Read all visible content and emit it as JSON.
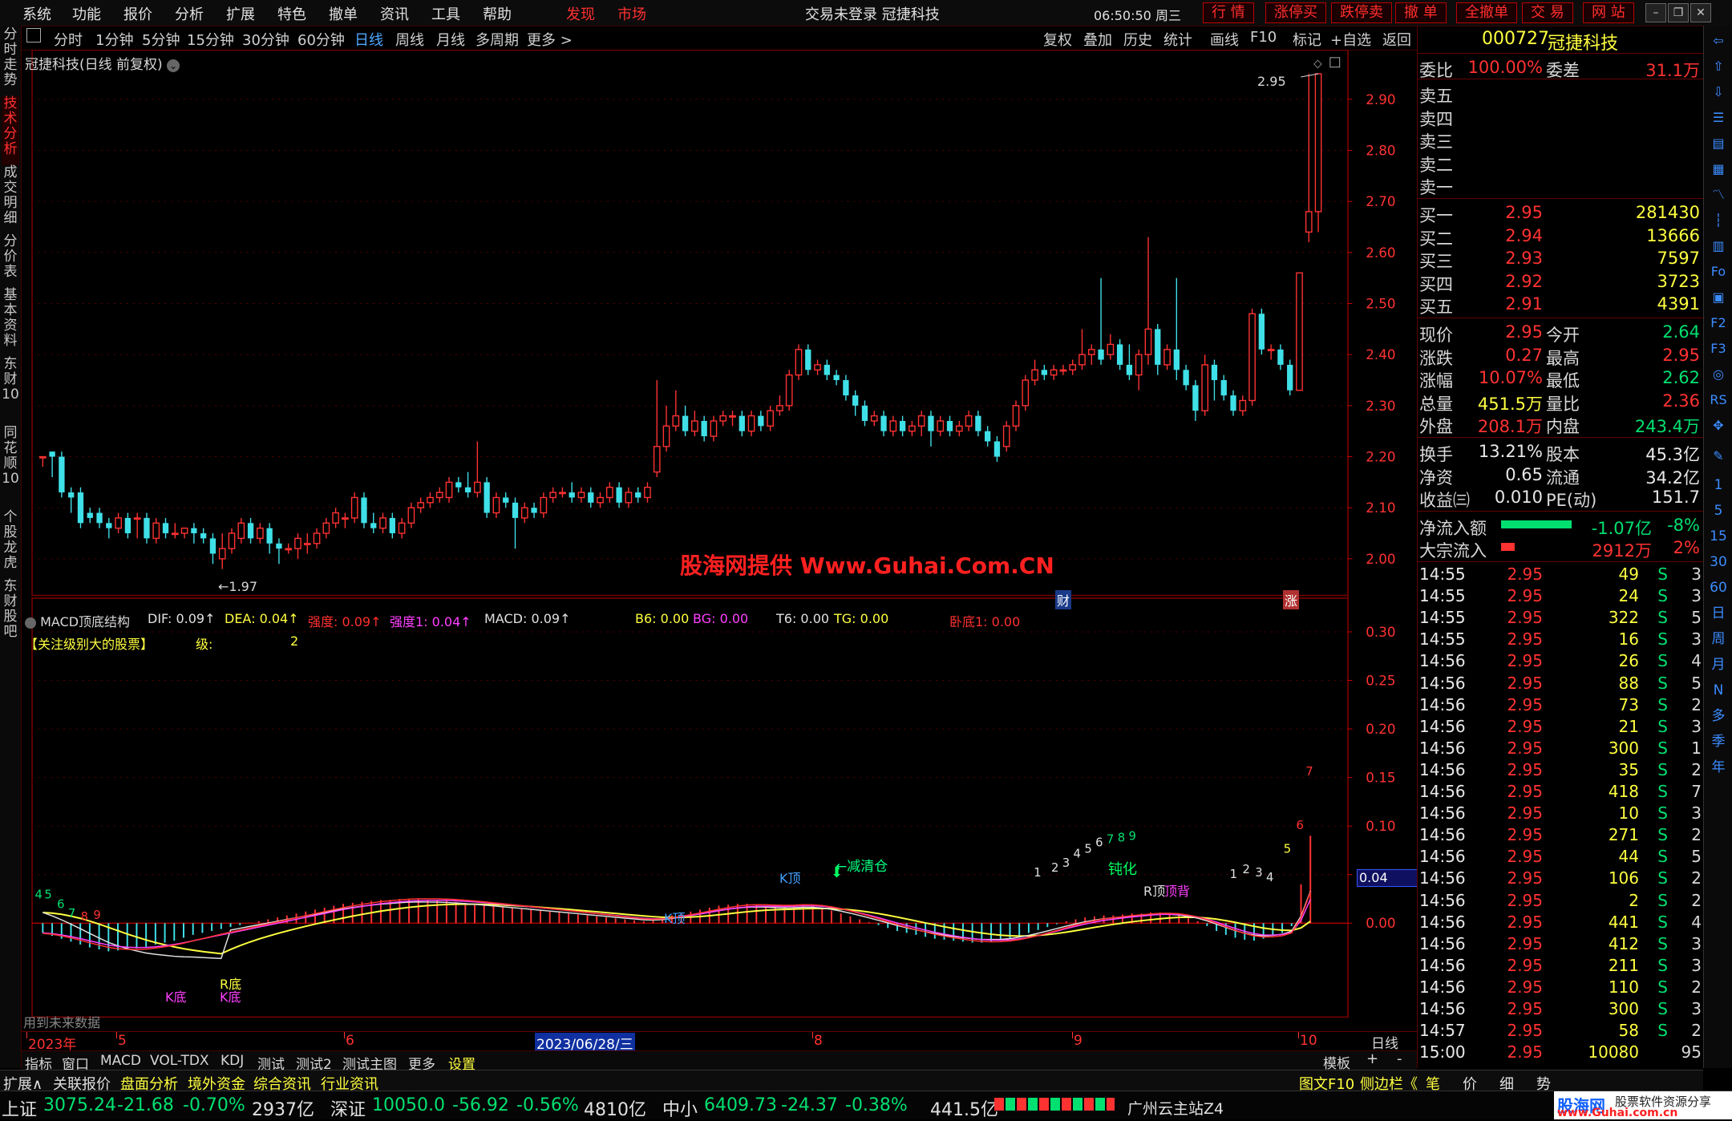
{
  "topbar": {
    "menus": [
      "系统",
      "功能",
      "报价",
      "分析",
      "扩展",
      "特色",
      "撤单",
      "资讯",
      "工具",
      "帮助"
    ],
    "discover": "发现",
    "market": "市场",
    "title": "交易未登录  冠捷科技",
    "time": "06:50:50 周三",
    "buttons": [
      "行  情",
      "涨停买",
      "跌停卖",
      "撤  单",
      "全撤单",
      "交  易",
      "网  站"
    ]
  },
  "left_tabs": [
    "分时走势",
    "技术分析",
    "成交明细",
    "分价表",
    "基本资料",
    "东财10",
    "同花顺10",
    "个股龙虎",
    "东财股吧"
  ],
  "period_bar": {
    "periods": [
      "分时",
      "1分钟",
      "5分钟",
      "15分钟",
      "30分钟",
      "60分钟",
      "日线",
      "周线",
      "月线",
      "多周期",
      "更多 >"
    ],
    "active_period": "日线",
    "tools": [
      "复权",
      "叠加",
      "历史",
      "统计",
      "画线",
      "F10",
      "标记",
      "+自选",
      "返回"
    ]
  },
  "main_chart": {
    "title": "冠捷科技(日线 前复权)",
    "high_label": "2.95",
    "low_label": "←1.97",
    "y_ticks": [
      "2.90",
      "2.80",
      "2.70",
      "2.60",
      "2.50",
      "2.40",
      "2.30",
      "2.20",
      "2.10",
      "2.00"
    ],
    "watermark": "股海网提供 Www.Guhai.Com.CN",
    "marker_cai": "财",
    "marker_zhang": "涨"
  },
  "indicator": {
    "name": "MACD顶底结构",
    "params": [
      {
        "text": "DIF: 0.09↑",
        "color": "#e0e0e0"
      },
      {
        "text": "DEA: 0.04↑",
        "color": "#ffff40"
      },
      {
        "text": "强度: 0.09↑",
        "color": "#ff3030"
      },
      {
        "text": "强度1: 0.04↑",
        "color": "#ff40ff"
      },
      {
        "text": "MACD: 0.09↑",
        "color": "#e0e0e0"
      },
      {
        "text": "B6: 0.00",
        "color": "#ffff40"
      },
      {
        "text": "BG: 0.00",
        "color": "#ff40ff"
      },
      {
        "text": "T6: 0.00",
        "color": "#e0e0e0"
      },
      {
        "text": "TG: 0.00",
        "color": "#ffff40"
      },
      {
        "text": "卧底1: 0.00",
        "color": "#ff3030"
      }
    ],
    "note_label": "【关注级别大的股票】",
    "level_label": "级:",
    "level_value": "2",
    "y_ticks": [
      "0.30",
      "0.25",
      "0.20",
      "0.15",
      "0.10",
      "0.05",
      "0.00"
    ],
    "current_value": "0.04",
    "future_note": "用到未来数据",
    "annotations": {
      "k_top_1": "K顶",
      "k_top_2": "K顶",
      "reduce": "减清仓",
      "dull": "钝化",
      "r_top": "R顶",
      "top_bottom": "顶背",
      "r_bottom": "R底",
      "k_bottom_1": "K底",
      "k_bottom_2": "K底"
    },
    "count_labels": [
      "4",
      "5",
      "6",
      "7",
      "8",
      "9",
      "1",
      "2",
      "3",
      "4",
      "5",
      "6",
      "7",
      "8",
      "9",
      "1",
      "2",
      "3",
      "4",
      "5",
      "6",
      "7"
    ]
  },
  "x_axis": {
    "labels": [
      "2023年",
      "5",
      "6",
      "2023/06/28/三",
      "8",
      "9",
      "10"
    ],
    "right_label": "日线"
  },
  "template_bar": {
    "label": "模板",
    "plus": "+",
    "minus": "-"
  },
  "indicator_tabs": [
    "指标",
    "窗口",
    "MACD",
    "VOL-TDX",
    "KDJ",
    "测试",
    "测试2",
    "测试主图",
    "更多",
    "设置"
  ],
  "function_tabs": [
    "扩展∧",
    "关联报价",
    "盘面分析",
    "境外资金",
    "综合资讯",
    "行业资讯"
  ],
  "function_tabs_right": [
    "图文F10",
    "侧边栏《"
  ],
  "right_bottom_tabs": [
    "笔",
    "价",
    "细",
    "势"
  ],
  "quote": {
    "code": "000727",
    "name": "冠捷科技",
    "weibi_label": "委比",
    "weibi": "100.00%",
    "weicha_label": "委差",
    "weicha": "31.1万",
    "sell": [
      {
        "label": "卖五",
        "price": "",
        "vol": ""
      },
      {
        "label": "卖四",
        "price": "",
        "vol": ""
      },
      {
        "label": "卖三",
        "price": "",
        "vol": ""
      },
      {
        "label": "卖二",
        "price": "",
        "vol": ""
      },
      {
        "label": "卖一",
        "price": "",
        "vol": ""
      }
    ],
    "buy": [
      {
        "label": "买一",
        "price": "2.95",
        "vol": "281430"
      },
      {
        "label": "买二",
        "price": "2.94",
        "vol": "13666"
      },
      {
        "label": "买三",
        "price": "2.93",
        "vol": "7597"
      },
      {
        "label": "买四",
        "price": "2.92",
        "vol": "3723"
      },
      {
        "label": "买五",
        "price": "2.91",
        "vol": "4391"
      }
    ],
    "stats": [
      {
        "l1": "现价",
        "v1": "2.95",
        "c1": "#ff3232",
        "l2": "今开",
        "v2": "2.64",
        "c2": "#00e070"
      },
      {
        "l1": "涨跌",
        "v1": "0.27",
        "c1": "#ff3232",
        "l2": "最高",
        "v2": "2.95",
        "c2": "#ff3232"
      },
      {
        "l1": "涨幅",
        "v1": "10.07%",
        "c1": "#ff3232",
        "l2": "最低",
        "v2": "2.62",
        "c2": "#00e070"
      },
      {
        "l1": "总量",
        "v1": "451.5万",
        "c1": "#ffff40",
        "l2": "量比",
        "v2": "2.36",
        "c2": "#ff3232"
      },
      {
        "l1": "外盘",
        "v1": "208.1万",
        "c1": "#ff3232",
        "l2": "内盘",
        "v2": "243.4万",
        "c2": "#00e070"
      }
    ],
    "stats2": [
      {
        "l1": "换手",
        "v1": "13.21%",
        "l2": "股本",
        "v2": "45.3亿"
      },
      {
        "l1": "净资",
        "v1": "0.65",
        "l2": "流通",
        "v2": "34.2亿"
      },
      {
        "l1": "收益㈢",
        "v1": "0.010",
        "l2": "PE(动)",
        "v2": "151.7"
      }
    ],
    "flow": [
      {
        "label": "净流入额",
        "value": "-1.07亿",
        "pct": "-8%",
        "color": "#00e070",
        "bar": "#00e070",
        "bar_frac": 0.8
      },
      {
        "label": "大宗流入",
        "value": "2912万",
        "pct": "2%",
        "color": "#ff3232",
        "bar": "#ff3232",
        "bar_frac": 0.15
      }
    ],
    "ticks": [
      {
        "t": "14:55",
        "p": "2.95",
        "v": "49",
        "s": "S",
        "n": "3"
      },
      {
        "t": "14:55",
        "p": "2.95",
        "v": "24",
        "s": "S",
        "n": "3"
      },
      {
        "t": "14:55",
        "p": "2.95",
        "v": "322",
        "s": "S",
        "n": "5"
      },
      {
        "t": "14:55",
        "p": "2.95",
        "v": "16",
        "s": "S",
        "n": "3"
      },
      {
        "t": "14:56",
        "p": "2.95",
        "v": "26",
        "s": "S",
        "n": "4"
      },
      {
        "t": "14:56",
        "p": "2.95",
        "v": "88",
        "s": "S",
        "n": "5"
      },
      {
        "t": "14:56",
        "p": "2.95",
        "v": "73",
        "s": "S",
        "n": "2"
      },
      {
        "t": "14:56",
        "p": "2.95",
        "v": "21",
        "s": "S",
        "n": "3"
      },
      {
        "t": "14:56",
        "p": "2.95",
        "v": "300",
        "s": "S",
        "n": "1"
      },
      {
        "t": "14:56",
        "p": "2.95",
        "v": "35",
        "s": "S",
        "n": "2"
      },
      {
        "t": "14:56",
        "p": "2.95",
        "v": "418",
        "s": "S",
        "n": "7"
      },
      {
        "t": "14:56",
        "p": "2.95",
        "v": "10",
        "s": "S",
        "n": "3"
      },
      {
        "t": "14:56",
        "p": "2.95",
        "v": "271",
        "s": "S",
        "n": "2"
      },
      {
        "t": "14:56",
        "p": "2.95",
        "v": "44",
        "s": "S",
        "n": "5"
      },
      {
        "t": "14:56",
        "p": "2.95",
        "v": "106",
        "s": "S",
        "n": "2"
      },
      {
        "t": "14:56",
        "p": "2.95",
        "v": "2",
        "s": "S",
        "n": "2"
      },
      {
        "t": "14:56",
        "p": "2.95",
        "v": "441",
        "s": "S",
        "n": "4"
      },
      {
        "t": "14:56",
        "p": "2.95",
        "v": "412",
        "s": "S",
        "n": "3"
      },
      {
        "t": "14:56",
        "p": "2.95",
        "v": "211",
        "s": "S",
        "n": "3"
      },
      {
        "t": "14:56",
        "p": "2.95",
        "v": "110",
        "s": "S",
        "n": "2"
      },
      {
        "t": "14:56",
        "p": "2.95",
        "v": "300",
        "s": "S",
        "n": "3"
      },
      {
        "t": "14:57",
        "p": "2.95",
        "v": "58",
        "s": "S",
        "n": "2"
      },
      {
        "t": "15:00",
        "p": "2.95",
        "v": "10080",
        "s": "",
        "n": "95"
      }
    ]
  },
  "right_icons": [
    "up-arrow-icon",
    "down-arrow-icon",
    "list-icon",
    "bar-icon",
    "grid-icon",
    "line-icon",
    "candle-icon",
    "table-icon",
    "f10-icon",
    "doc-icon",
    "f2-icon",
    "f3-icon",
    "compass-icon",
    "rsi-icon",
    "move-icon",
    "pen-icon",
    "f5-icon"
  ],
  "right_periods": [
    "1",
    "5",
    "15",
    "30",
    "60",
    "日",
    "周",
    "月",
    "N",
    "多",
    "季",
    "年"
  ],
  "status": {
    "sh_label": "上证",
    "sh": "3075.24",
    "sh_chg": "-21.68",
    "sh_pct": "-0.70%",
    "sh_amt": "2937亿",
    "sz_label": "深证",
    "sz": "10050.0",
    "sz_chg": "-56.92",
    "sz_pct": "-0.56%",
    "sz_amt": "4810亿",
    "zx_label": "中小",
    "zx": "6409.73",
    "zx_chg": "-24.37",
    "zx_pct": "-0.38%",
    "zx_amt": "441.5亿",
    "server": "广州云主站Z4",
    "logo": "股海网",
    "logo_sub": "股票软件资源分享",
    "logo_url": "www.Guhai.com.cn"
  },
  "candles": [
    [
      2.2,
      2.2,
      2.18,
      2.2
    ],
    [
      2.21,
      2.2,
      2.16,
      2.21
    ],
    [
      2.2,
      2.13,
      2.12,
      2.21
    ],
    [
      2.13,
      2.12,
      2.09,
      2.14
    ],
    [
      2.13,
      2.07,
      2.06,
      2.14
    ],
    [
      2.09,
      2.08,
      2.07,
      2.1
    ],
    [
      2.09,
      2.07,
      2.06,
      2.1
    ],
    [
      2.07,
      2.06,
      2.04,
      2.08
    ],
    [
      2.06,
      2.08,
      2.05,
      2.09
    ],
    [
      2.08,
      2.05,
      2.04,
      2.09
    ],
    [
      2.08,
      2.08,
      2.04,
      2.09
    ],
    [
      2.08,
      2.04,
      2.03,
      2.09
    ],
    [
      2.04,
      2.07,
      2.03,
      2.08
    ],
    [
      2.07,
      2.05,
      2.04,
      2.08
    ],
    [
      2.05,
      2.05,
      2.04,
      2.07
    ],
    [
      2.05,
      2.06,
      2.04,
      2.06
    ],
    [
      2.06,
      2.05,
      2.03,
      2.07
    ],
    [
      2.05,
      2.04,
      2.03,
      2.06
    ],
    [
      2.04,
      2.01,
      1.99,
      2.05
    ],
    [
      2.0,
      2.02,
      1.98,
      2.05
    ],
    [
      2.02,
      2.05,
      2.01,
      2.06
    ],
    [
      2.04,
      2.07,
      2.03,
      2.08
    ],
    [
      2.07,
      2.04,
      2.03,
      2.08
    ],
    [
      2.04,
      2.06,
      2.03,
      2.07
    ],
    [
      2.06,
      2.03,
      2.01,
      2.07
    ],
    [
      2.03,
      2.02,
      1.99,
      2.04
    ],
    [
      2.02,
      2.02,
      2.01,
      2.03
    ],
    [
      2.02,
      2.04,
      2.0,
      2.05
    ],
    [
      2.03,
      2.03,
      2.01,
      2.05
    ],
    [
      2.03,
      2.05,
      2.02,
      2.06
    ],
    [
      2.05,
      2.07,
      2.04,
      2.08
    ],
    [
      2.07,
      2.09,
      2.06,
      2.1
    ],
    [
      2.08,
      2.08,
      2.06,
      2.09
    ],
    [
      2.08,
      2.12,
      2.07,
      2.13
    ],
    [
      2.12,
      2.07,
      2.06,
      2.13
    ],
    [
      2.07,
      2.06,
      2.05,
      2.09
    ],
    [
      2.06,
      2.08,
      2.05,
      2.09
    ],
    [
      2.08,
      2.05,
      2.04,
      2.09
    ],
    [
      2.05,
      2.07,
      2.04,
      2.08
    ],
    [
      2.07,
      2.1,
      2.06,
      2.11
    ],
    [
      2.1,
      2.11,
      2.09,
      2.12
    ],
    [
      2.11,
      2.12,
      2.1,
      2.13
    ],
    [
      2.12,
      2.13,
      2.11,
      2.14
    ],
    [
      2.12,
      2.15,
      2.11,
      2.16
    ],
    [
      2.15,
      2.14,
      2.13,
      2.16
    ],
    [
      2.14,
      2.13,
      2.12,
      2.17
    ],
    [
      2.13,
      2.15,
      2.12,
      2.23
    ],
    [
      2.15,
      2.09,
      2.08,
      2.16
    ],
    [
      2.09,
      2.12,
      2.08,
      2.13
    ],
    [
      2.12,
      2.11,
      2.1,
      2.13
    ],
    [
      2.11,
      2.08,
      2.02,
      2.12
    ],
    [
      2.08,
      2.1,
      2.07,
      2.11
    ],
    [
      2.1,
      2.09,
      2.08,
      2.11
    ],
    [
      2.09,
      2.12,
      2.08,
      2.13
    ],
    [
      2.12,
      2.13,
      2.11,
      2.14
    ],
    [
      2.13,
      2.13,
      2.12,
      2.14
    ],
    [
      2.13,
      2.12,
      2.11,
      2.15
    ],
    [
      2.12,
      2.13,
      2.11,
      2.14
    ],
    [
      2.13,
      2.11,
      2.1,
      2.14
    ],
    [
      2.11,
      2.12,
      2.1,
      2.13
    ],
    [
      2.12,
      2.14,
      2.11,
      2.15
    ],
    [
      2.14,
      2.11,
      2.1,
      2.15
    ],
    [
      2.11,
      2.13,
      2.1,
      2.14
    ],
    [
      2.13,
      2.12,
      2.11,
      2.14
    ],
    [
      2.12,
      2.14,
      2.11,
      2.15
    ],
    [
      2.17,
      2.22,
      2.16,
      2.35
    ],
    [
      2.22,
      2.26,
      2.21,
      2.3
    ],
    [
      2.26,
      2.28,
      2.25,
      2.33
    ],
    [
      2.28,
      2.25,
      2.24,
      2.3
    ],
    [
      2.25,
      2.27,
      2.24,
      2.29
    ],
    [
      2.27,
      2.24,
      2.23,
      2.28
    ],
    [
      2.24,
      2.27,
      2.23,
      2.28
    ],
    [
      2.27,
      2.28,
      2.26,
      2.29
    ],
    [
      2.28,
      2.28,
      2.26,
      2.29
    ],
    [
      2.28,
      2.25,
      2.24,
      2.29
    ],
    [
      2.25,
      2.28,
      2.24,
      2.29
    ],
    [
      2.28,
      2.26,
      2.25,
      2.29
    ],
    [
      2.26,
      2.29,
      2.25,
      2.3
    ],
    [
      2.29,
      2.3,
      2.28,
      2.32
    ],
    [
      2.3,
      2.36,
      2.29,
      2.37
    ],
    [
      2.36,
      2.41,
      2.35,
      2.42
    ],
    [
      2.41,
      2.37,
      2.36,
      2.42
    ],
    [
      2.37,
      2.38,
      2.36,
      2.39
    ],
    [
      2.38,
      2.36,
      2.35,
      2.39
    ],
    [
      2.36,
      2.35,
      2.34,
      2.37
    ],
    [
      2.35,
      2.32,
      2.31,
      2.36
    ],
    [
      2.32,
      2.3,
      2.28,
      2.33
    ],
    [
      2.3,
      2.27,
      2.26,
      2.31
    ],
    [
      2.27,
      2.28,
      2.26,
      2.29
    ],
    [
      2.28,
      2.25,
      2.24,
      2.29
    ],
    [
      2.25,
      2.27,
      2.24,
      2.28
    ],
    [
      2.27,
      2.25,
      2.24,
      2.28
    ],
    [
      2.25,
      2.26,
      2.24,
      2.27
    ],
    [
      2.26,
      2.28,
      2.24,
      2.29
    ],
    [
      2.28,
      2.25,
      2.22,
      2.29
    ],
    [
      2.25,
      2.27,
      2.24,
      2.28
    ],
    [
      2.27,
      2.25,
      2.24,
      2.28
    ],
    [
      2.25,
      2.26,
      2.24,
      2.27
    ],
    [
      2.26,
      2.28,
      2.25,
      2.29
    ],
    [
      2.28,
      2.25,
      2.24,
      2.29
    ],
    [
      2.25,
      2.23,
      2.22,
      2.26
    ],
    [
      2.23,
      2.2,
      2.19,
      2.24
    ],
    [
      2.22,
      2.26,
      2.21,
      2.27
    ],
    [
      2.26,
      2.3,
      2.25,
      2.31
    ],
    [
      2.3,
      2.35,
      2.29,
      2.36
    ],
    [
      2.35,
      2.37,
      2.34,
      2.39
    ],
    [
      2.37,
      2.36,
      2.35,
      2.38
    ],
    [
      2.36,
      2.37,
      2.35,
      2.38
    ],
    [
      2.37,
      2.37,
      2.36,
      2.38
    ],
    [
      2.37,
      2.38,
      2.36,
      2.39
    ],
    [
      2.38,
      2.4,
      2.37,
      2.45
    ],
    [
      2.4,
      2.41,
      2.38,
      2.42
    ],
    [
      2.41,
      2.39,
      2.38,
      2.55
    ],
    [
      2.4,
      2.42,
      2.39,
      2.44
    ],
    [
      2.42,
      2.38,
      2.37,
      2.43
    ],
    [
      2.38,
      2.36,
      2.35,
      2.42
    ],
    [
      2.36,
      2.4,
      2.33,
      2.41
    ],
    [
      2.4,
      2.45,
      2.38,
      2.63
    ],
    [
      2.45,
      2.38,
      2.36,
      2.46
    ],
    [
      2.38,
      2.41,
      2.37,
      2.42
    ],
    [
      2.41,
      2.37,
      2.35,
      2.55
    ],
    [
      2.37,
      2.34,
      2.33,
      2.38
    ],
    [
      2.34,
      2.29,
      2.27,
      2.35
    ],
    [
      2.29,
      2.38,
      2.28,
      2.4
    ],
    [
      2.38,
      2.35,
      2.31,
      2.39
    ],
    [
      2.35,
      2.32,
      2.31,
      2.36
    ],
    [
      2.32,
      2.29,
      2.28,
      2.33
    ],
    [
      2.29,
      2.31,
      2.28,
      2.32
    ],
    [
      2.31,
      2.48,
      2.3,
      2.49
    ],
    [
      2.48,
      2.41,
      2.4,
      2.49
    ],
    [
      2.41,
      2.41,
      2.39,
      2.42
    ],
    [
      2.41,
      2.38,
      2.37,
      2.42
    ],
    [
      2.38,
      2.33,
      2.32,
      2.39
    ],
    [
      2.33,
      2.56,
      2.34,
      2.56
    ],
    [
      2.64,
      2.68,
      2.62,
      2.95
    ],
    [
      2.68,
      2.95,
      2.64,
      2.95
    ]
  ],
  "macd": [
    -0.01,
    -0.013,
    -0.016,
    -0.019,
    -0.022,
    -0.025,
    -0.027,
    -0.029,
    -0.028,
    -0.027,
    -0.026,
    -0.025,
    -0.022,
    -0.02,
    -0.018,
    -0.015,
    -0.012,
    -0.01,
    -0.008,
    -0.006,
    -0.004,
    -0.002,
    0.0,
    0.002,
    0.004,
    0.006,
    0.008,
    0.01,
    0.012,
    0.014,
    0.016,
    0.018,
    0.02,
    0.021,
    0.022,
    0.023,
    0.024,
    0.024,
    0.025,
    0.025,
    0.025,
    0.024,
    0.024,
    0.023,
    0.022,
    0.021,
    0.02,
    0.019,
    0.018,
    0.017,
    0.016,
    0.015,
    0.014,
    0.013,
    0.012,
    0.011,
    0.01,
    0.009,
    0.008,
    0.007,
    0.006,
    0.005,
    0.004,
    0.003,
    0.002,
    0.003,
    0.005,
    0.008,
    0.01,
    0.012,
    0.014,
    0.016,
    0.018,
    0.019,
    0.02,
    0.02,
    0.019,
    0.018,
    0.017,
    0.017,
    0.018,
    0.019,
    0.018,
    0.016,
    0.013,
    0.01,
    0.007,
    0.004,
    0.001,
    -0.002,
    -0.005,
    -0.008,
    -0.01,
    -0.012,
    -0.014,
    -0.016,
    -0.017,
    -0.018,
    -0.019,
    -0.02,
    -0.02,
    -0.019,
    -0.018,
    -0.016,
    -0.013,
    -0.01,
    -0.007,
    -0.004,
    -0.001,
    0.002,
    0.004,
    0.006,
    0.007,
    0.008,
    0.008,
    0.009,
    0.01,
    0.01,
    0.011,
    0.011,
    0.01,
    0.008,
    0.005,
    0.002,
    -0.003,
    -0.008,
    -0.012,
    -0.015,
    -0.017,
    -0.018,
    -0.016,
    -0.013,
    -0.01,
    -0.003,
    0.04,
    0.09
  ]
}
